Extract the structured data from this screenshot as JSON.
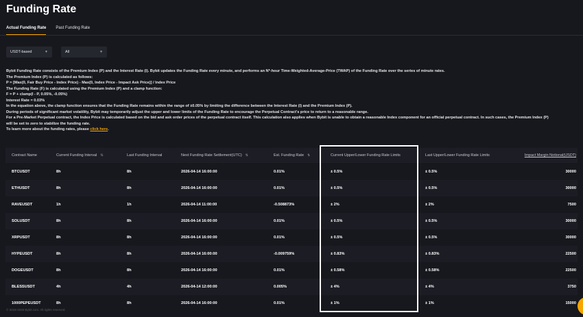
{
  "page": {
    "title": "Funding Rate"
  },
  "tabs": [
    {
      "label": "Actual Funding Rate",
      "active": true
    },
    {
      "label": "Past Funding Rate",
      "active": false
    }
  ],
  "filters": {
    "contract_type": "USDT-based",
    "category": "All",
    "chevron_icon": "chevron-down-icon"
  },
  "description": {
    "line1": "Bybit Funding Rate consists of the Premium Index (P) and the Interest Rate (I). Bybit updates the Funding Rate every minute, and performs an N*-hour Time-Weighted-Average-Price (TWAP) of the Funding Rate over the series of minute rates.",
    "line2": "The Premium Index (P) is calculated as follows:",
    "line3": "P = [Max(0, Fair Buy Price - Index Price) - Max(0, Index Price - Impact Ask Price)] / Index Price",
    "line4": "The Funding Rate (F) is calculated using the Premium Index (P) and a clamp function:",
    "line5": "F = P + clamp(I - P, 0.05%, -0.05%)",
    "line6": "Interest Rate = 0.03%",
    "line7": "In the equation above, the clamp function ensures that the Funding Rate remains within the range of ±0.05% by limiting the difference between the Interest Rate (I) and the Premium Index (P).",
    "line8": "During periods of significant market volatility, Bybit may temporarily adjust the upper and lower limits of the Funding Rate to encourage the Perpetual Contract's price to return to a reasonable range.",
    "line9": "For a Pre-Market Perpetual contract, the Index Price is calculated based on the bid and ask order prices of the perpetual contract itself. This calculation also applies when Bybit is unable to obtain a reasonable Index component for an official perpetual contract. In such cases, the Premium Index (P)",
    "line10": "will be set to zero to stabilize the funding rate.",
    "line11_prefix": "To learn more about the funding rates, please ",
    "link_text": "click here",
    "line11_suffix": "."
  },
  "table": {
    "headers": {
      "contract": "Contract Name",
      "current_interval": "Current Funding Interval",
      "last_interval": "Last Funding Interval",
      "next_settlement": "Next Funding Rate Settlement(UTC)",
      "est_rate": "Est. Funding Rate",
      "current_limits": "Current Upper/Lower Funding Rate Limits",
      "last_limits": "Last Upper/Lower Funding Rate Limits",
      "impact_margin": "Impact Margin Notional(USDT)"
    },
    "sort_icon": "sort-icon",
    "rows": [
      {
        "contract": "BTCUSDT",
        "current_interval": "8h",
        "last_interval": "8h",
        "next_settlement": "2026-04-14 16:00:00",
        "est_rate": "0.01%",
        "current_limits": "± 0.5%",
        "last_limits": "± 0.5%",
        "impact_margin": "30000"
      },
      {
        "contract": "ETHUSDT",
        "current_interval": "8h",
        "last_interval": "8h",
        "next_settlement": "2026-04-14 16:00:00",
        "est_rate": "0.01%",
        "current_limits": "± 0.5%",
        "last_limits": "± 0.5%",
        "impact_margin": "30000"
      },
      {
        "contract": "RAVEUSDT",
        "current_interval": "1h",
        "last_interval": "1h",
        "next_settlement": "2026-04-14 11:00:00",
        "est_rate": "-0.508873%",
        "current_limits": "± 2%",
        "last_limits": "± 2%",
        "impact_margin": "7500"
      },
      {
        "contract": "SOLUSDT",
        "current_interval": "8h",
        "last_interval": "8h",
        "next_settlement": "2026-04-14 16:00:00",
        "est_rate": "0.01%",
        "current_limits": "± 0.5%",
        "last_limits": "± 0.5%",
        "impact_margin": "30000"
      },
      {
        "contract": "XRPUSDT",
        "current_interval": "8h",
        "last_interval": "8h",
        "next_settlement": "2026-04-14 16:00:00",
        "est_rate": "0.01%",
        "current_limits": "± 0.5%",
        "last_limits": "± 0.5%",
        "impact_margin": "30000"
      },
      {
        "contract": "HYPEUSDT",
        "current_interval": "8h",
        "last_interval": "8h",
        "next_settlement": "2026-04-14 16:00:00",
        "est_rate": "-0.009759%",
        "current_limits": "± 0.83%",
        "last_limits": "± 0.83%",
        "impact_margin": "22500"
      },
      {
        "contract": "DOGEUSDT",
        "current_interval": "8h",
        "last_interval": "8h",
        "next_settlement": "2026-04-14 16:00:00",
        "est_rate": "0.01%",
        "current_limits": "± 0.58%",
        "last_limits": "± 0.58%",
        "impact_margin": "22500"
      },
      {
        "contract": "BLESSUSDT",
        "current_interval": "4h",
        "last_interval": "4h",
        "next_settlement": "2026-04-14 12:00:00",
        "est_rate": "0.005%",
        "current_limits": "± 4%",
        "last_limits": "± 4%",
        "impact_margin": "3750"
      },
      {
        "contract": "1000PEPEUSDT",
        "current_interval": "8h",
        "last_interval": "8h",
        "next_settlement": "2026-04-14 16:00:00",
        "est_rate": "0.01%",
        "current_limits": "± 1%",
        "last_limits": "± 1%",
        "impact_margin": "15000"
      }
    ]
  },
  "footer": {
    "copyright": "© 2018-2026 Bybit.com. All rights reserved."
  },
  "colors": {
    "accent": "#f7a600",
    "background": "#17181e",
    "row_alt": "#1c1d24"
  }
}
